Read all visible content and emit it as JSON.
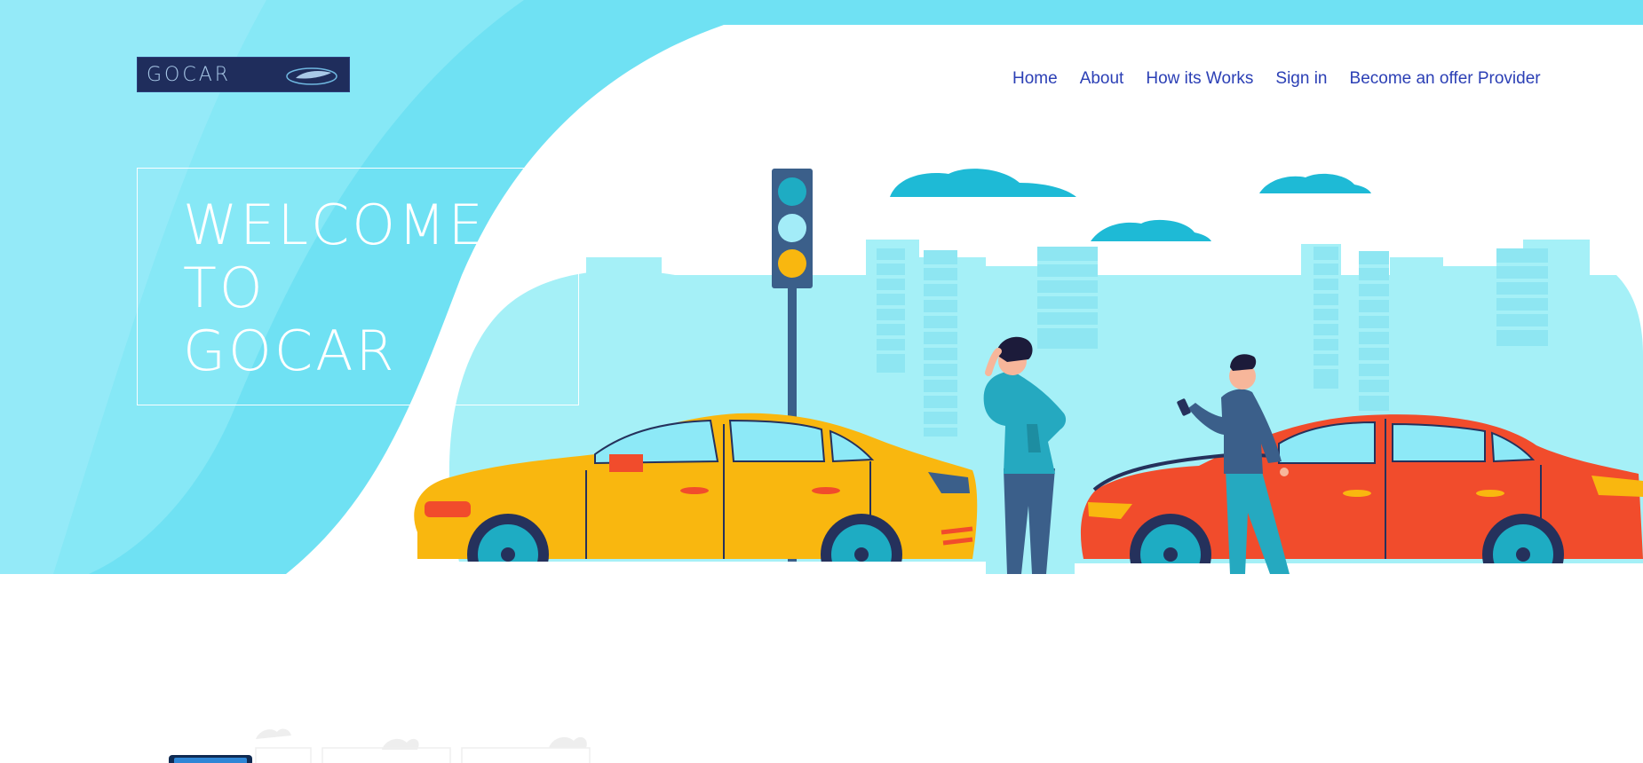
{
  "header": {
    "logo_text": "GOCAR",
    "nav": [
      {
        "label": "Home"
      },
      {
        "label": "About"
      },
      {
        "label": "How its Works"
      },
      {
        "label": "Sign in"
      },
      {
        "label": "Become an offer Provider"
      }
    ]
  },
  "hero": {
    "welcome_lines": [
      "WELCOME",
      "TO",
      "GOCAR"
    ]
  },
  "colors": {
    "hero_cyan": "#6fe1f3",
    "nav_blue": "#2b3fb5",
    "logo_bg": "#1f2d5c",
    "car_yellow": "#f9b70f",
    "car_red": "#f14c2c",
    "city_light": "#a5f0f7",
    "cloud_blue": "#1ebad6"
  }
}
